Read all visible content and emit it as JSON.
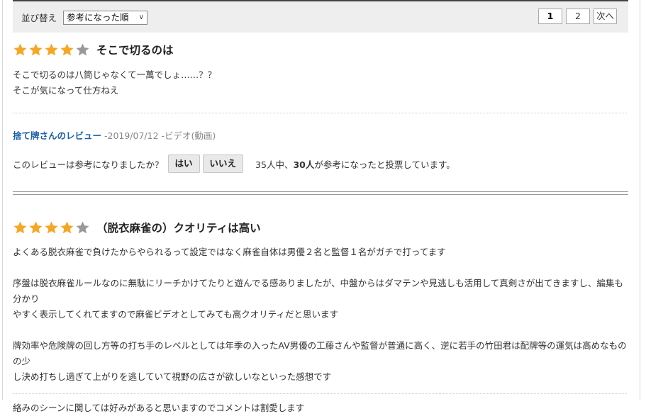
{
  "sort": {
    "label": "並び替え",
    "selected": "参考になった順",
    "chevron": "∨"
  },
  "pager": {
    "current": "1",
    "page2": "2",
    "next": "次へ"
  },
  "colors": {
    "star_on": "#f5a623",
    "star_off": "#999999",
    "author_link": "#1a5fa8"
  },
  "reviews": [
    {
      "rating": 4,
      "title": "そこで切るのは",
      "body": [
        "そこで切るのは八筒じゃなくて一萬でしょ……？？",
        "そこが気になって仕方ねえ"
      ],
      "author": "捨て牌さんのレビュー",
      "meta": " -2019/07/12 -ビデオ(動画)",
      "vote": {
        "question": "このレビューは参考になりましたか？",
        "yes": "はい",
        "no": "いいえ",
        "count_prefix": "35人中、",
        "count_bold": "30人",
        "count_suffix": "が参考になったと投票しています。"
      }
    },
    {
      "rating": 4,
      "title": "（脱衣麻雀の）クオリティは高い",
      "paragraphs": [
        [
          "よくある脱衣麻雀で負けたからやられるって設定ではなく麻雀自体は男優２名と監督１名がガチで打ってます"
        ],
        [
          "序盤は脱衣麻雀ルールなのに無駄にリーチかけてたりと遊んでる感ありましたが、中盤からはダマテンや見逃しも活用して真剣さが出てきますし、編集も分かり",
          "やすく表示してくれてますので麻雀ビデオとしてみても高クオリティだと思います"
        ],
        [
          "牌効率や危険牌の回し方等の打ち手のレベルとしては年季の入ったAV男優の工藤さんや監督が普通に高く、逆に若手の竹田君は配牌等の運気は高めなものの少",
          "し決め打ちし過ぎて上がりを逃していて視野の広さが欲しいなといった感想です"
        ],
        [
          "絡みのシーンに関しては好みがあると思いますのでコメントは割愛します"
        ]
      ]
    }
  ]
}
